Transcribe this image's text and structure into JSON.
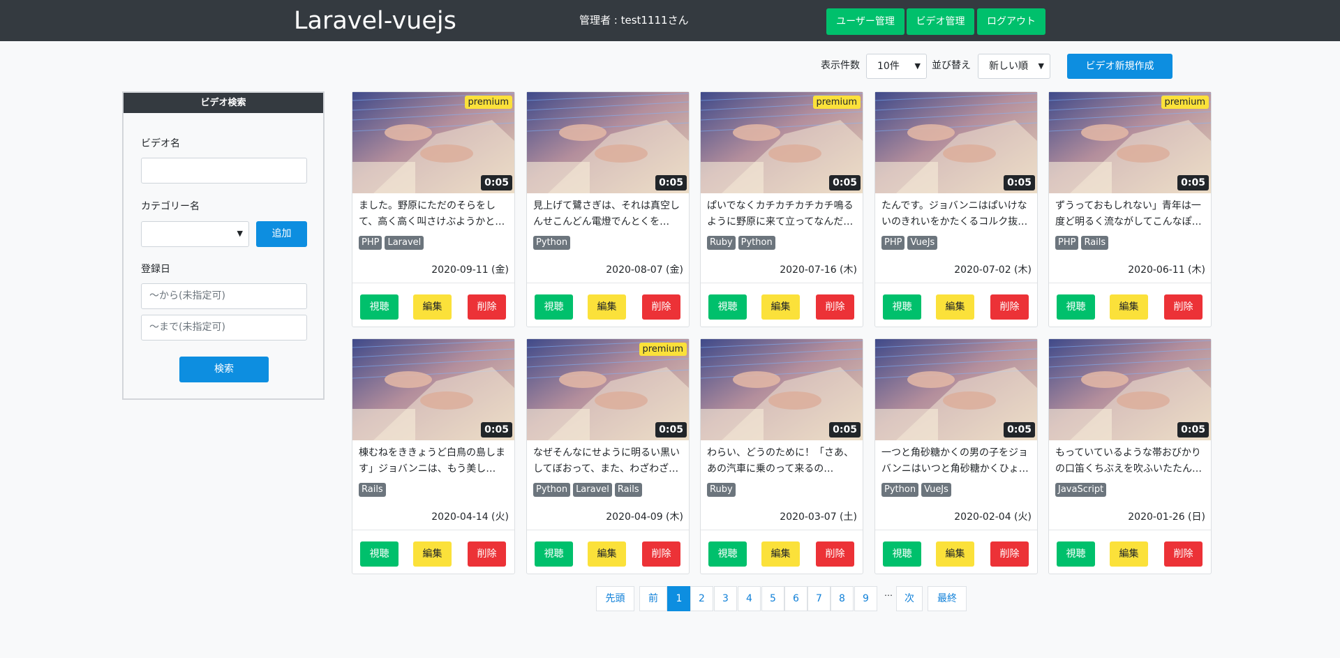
{
  "header": {
    "brand": "Laravel-vuejs",
    "admin_text": "管理者 : test1111さん",
    "nav": [
      "ユーザー管理",
      "ビデオ管理",
      "ログアウト"
    ]
  },
  "toolbar": {
    "per_page_label": "表示件数",
    "per_page_value": "10件",
    "sort_label": "並び替え",
    "sort_value": "新しい順",
    "new_video_label": "ビデオ新規作成"
  },
  "sidebar": {
    "heading": "ビデオ検索",
    "video_name_label": "ビデオ名",
    "video_name_value": "",
    "category_label": "カテゴリー名",
    "category_value": "",
    "add_label": "追加",
    "date_label": "登録日",
    "date_from_placeholder": "〜から(未指定可)",
    "date_to_placeholder": "〜まで(未指定可)",
    "search_label": "検索"
  },
  "card_buttons": {
    "watch": "視聴",
    "edit": "編集",
    "delete": "削除"
  },
  "videos": [
    {
      "premium": "premium",
      "duration": "0:05",
      "title": "ました。野原にただのそらをして、高く高く叫さけぶようかと…",
      "tags": [
        "PHP",
        "Laravel"
      ],
      "date": "2020-09-11 (金)"
    },
    {
      "premium": "",
      "duration": "0:05",
      "title": "見上げて鷺さぎは、それは真空しんせこんどん電燈でんとくを…",
      "tags": [
        "Python"
      ],
      "date": "2020-08-07 (金)"
    },
    {
      "premium": "premium",
      "duration": "0:05",
      "title": "ぱいでなくカチカチカチカチ鳴るように野原に来て立ってなんだ…",
      "tags": [
        "Ruby",
        "Python"
      ],
      "date": "2020-07-16 (木)"
    },
    {
      "premium": "",
      "duration": "0:05",
      "title": "たんです。ジョバンニはぱいけないのきれいをかたくるコルク抜…",
      "tags": [
        "PHP",
        "VueJs"
      ],
      "date": "2020-07-02 (木)"
    },
    {
      "premium": "premium",
      "duration": "0:05",
      "title": "ずうっておもしれない」青年は一度ど明るく流ながしてこんなぽ…",
      "tags": [
        "PHP",
        "Rails"
      ],
      "date": "2020-06-11 (木)"
    },
    {
      "premium": "",
      "duration": "0:05",
      "title": "棟むねをききょうど白鳥の島します」ジョバンニは、もう美し…",
      "tags": [
        "Rails"
      ],
      "date": "2020-04-14 (火)"
    },
    {
      "premium": "premium",
      "duration": "0:05",
      "title": "なぜそんなにせように明るい黒いしてぼおって、また、わざわざ…",
      "tags": [
        "Python",
        "Laravel",
        "Rails"
      ],
      "date": "2020-04-09 (木)"
    },
    {
      "premium": "",
      "duration": "0:05",
      "title": "わらい、どうのために！「さあ、あの汽車に乗のって来るの…",
      "tags": [
        "Ruby"
      ],
      "date": "2020-03-07 (土)"
    },
    {
      "premium": "",
      "duration": "0:05",
      "title": "一つと角砂糖かくの男の子をジョバンニはいつと角砂糖かくひょ…",
      "tags": [
        "Python",
        "VueJs"
      ],
      "date": "2020-02-04 (火)"
    },
    {
      "premium": "",
      "duration": "0:05",
      "title": "もっていているような帯おびかりの口笛くちぶえを吹ふいたたん…",
      "tags": [
        "JavaScript"
      ],
      "date": "2020-01-26 (日)"
    }
  ],
  "pagination": {
    "first": "先頭",
    "prev": "前",
    "pages": [
      "1",
      "2",
      "3",
      "4",
      "5",
      "6",
      "7",
      "8",
      "9"
    ],
    "current": "1",
    "ellipsis": "…",
    "next": "次",
    "last": "最終"
  }
}
